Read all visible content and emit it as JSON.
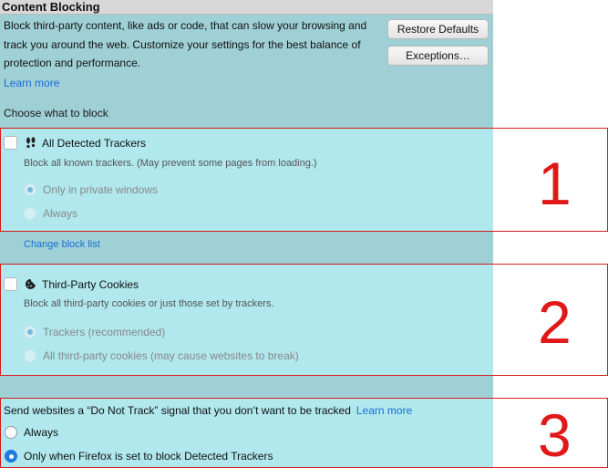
{
  "header": {
    "title": "Content Blocking"
  },
  "intro": {
    "text": "Block third-party content, like ads or code, that can slow your browsing and track you around the web. Customize your settings for the best balance of protection and performance.",
    "learn_more": "Learn more"
  },
  "buttons": {
    "restore_defaults": "Restore Defaults",
    "exceptions": "Exceptions…"
  },
  "choose_label": "Choose what to block",
  "trackers": {
    "title": "All Detected Trackers",
    "icon": "footprints-icon",
    "description": "Block all known trackers. (May prevent some pages from loading.)",
    "options": [
      "Only in private windows",
      "Always"
    ],
    "selected": "Only in private windows",
    "change_block_list": "Change block list"
  },
  "cookies": {
    "title": "Third-Party Cookies",
    "icon": "cookie-icon",
    "description": "Block all third-party cookies or just those set by trackers.",
    "options": [
      "Trackers (recommended)",
      "All third-party cookies (may cause websites to break)"
    ],
    "selected": "Trackers (recommended)"
  },
  "dnt": {
    "text": "Send websites a “Do Not Track” signal that you don’t want to be tracked",
    "learn_more": "Learn more",
    "options": [
      "Always",
      "Only when Firefox is set to block Detected Trackers"
    ],
    "selected": "Only when Firefox is set to block Detected Trackers"
  },
  "annotations": [
    "1",
    "2",
    "3"
  ],
  "colors": {
    "annotation": "#e01818",
    "link": "#1a6fd6",
    "highlight": "#b0e8ee",
    "pane": "#9fd0d6"
  }
}
